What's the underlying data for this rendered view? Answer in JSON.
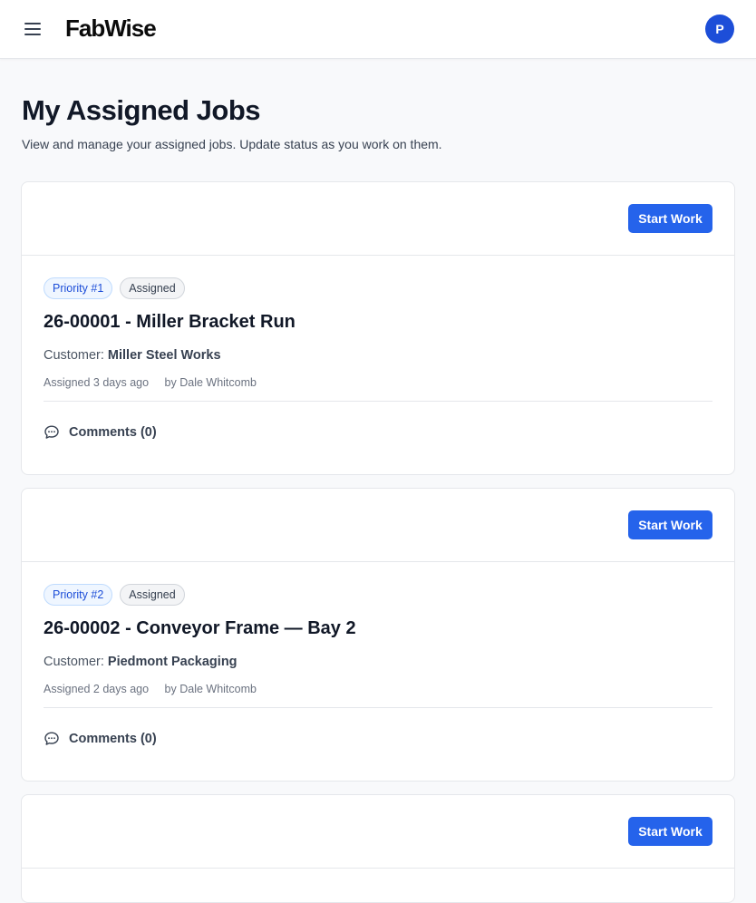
{
  "app": {
    "name": "FabWise",
    "avatar_initial": "P"
  },
  "page": {
    "title": "My Assigned Jobs",
    "subtitle": "View and manage your assigned jobs. Update status as you work on them."
  },
  "jobs": [
    {
      "action_label": "Start Work",
      "priority": "Priority #1",
      "status": "Assigned",
      "title": "26-00001 - Miller Bracket Run",
      "customer_label": "Customer:",
      "customer": "Miller Steel Works",
      "assigned": "Assigned 3 days ago",
      "assigned_by": "by Dale Whitcomb",
      "comments": "Comments (0)"
    },
    {
      "action_label": "Start Work",
      "priority": "Priority #2",
      "status": "Assigned",
      "title": "26-00002 - Conveyor Frame — Bay 2",
      "customer_label": "Customer:",
      "customer": "Piedmont Packaging",
      "assigned": "Assigned 2 days ago",
      "assigned_by": "by Dale Whitcomb",
      "comments": "Comments (0)"
    },
    {
      "action_label": "Start Work"
    }
  ],
  "colors": {
    "primary": "#2563eb",
    "avatar": "#1d4ed8",
    "priority_badge_text": "#1d4ed8"
  },
  "icons": [
    "menu-icon",
    "comment-icon"
  ]
}
